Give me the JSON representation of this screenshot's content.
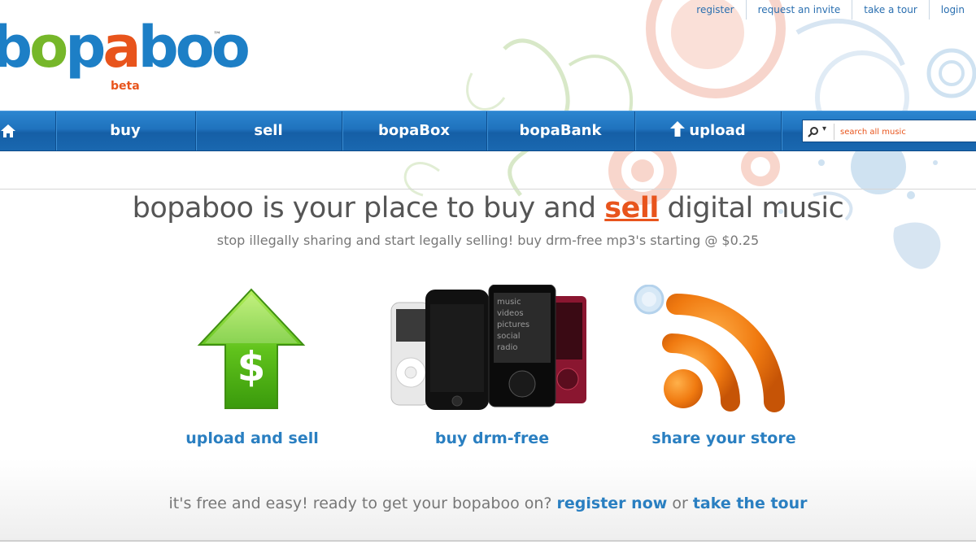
{
  "brand": {
    "logo_letters": [
      "b",
      "o",
      "p",
      "a",
      "boo"
    ],
    "trademark": "™",
    "beta": "beta"
  },
  "top_links": [
    "register",
    "request an invite",
    "take a tour",
    "login"
  ],
  "nav": {
    "items": [
      "buy",
      "sell",
      "bopaBox",
      "bopaBank",
      "upload"
    ],
    "search_placeholder": "search all music"
  },
  "main": {
    "headline_pre": "bopaboo is your place to buy and ",
    "headline_emph": "sell",
    "headline_post": " digital music",
    "subheadline": "stop illegally sharing and start legally selling! buy drm-free mp3's starting @ $0.25",
    "features": [
      {
        "label": "upload and sell"
      },
      {
        "label": "buy drm-free"
      },
      {
        "label": "share your store"
      }
    ],
    "player_screen_lines": [
      "music",
      "videos",
      "pictures",
      "social",
      "radio"
    ],
    "cta_text": "it's free and easy! ready to get your bopaboo on? ",
    "cta_link1": "register now",
    "cta_mid": " or ",
    "cta_link2": "take the tour"
  },
  "colors": {
    "brand_blue": "#1d7fc6",
    "brand_green": "#76b72a",
    "brand_orange": "#e8541c",
    "nav_blue": "#1f72bd",
    "link_blue": "#2a7fc1"
  }
}
